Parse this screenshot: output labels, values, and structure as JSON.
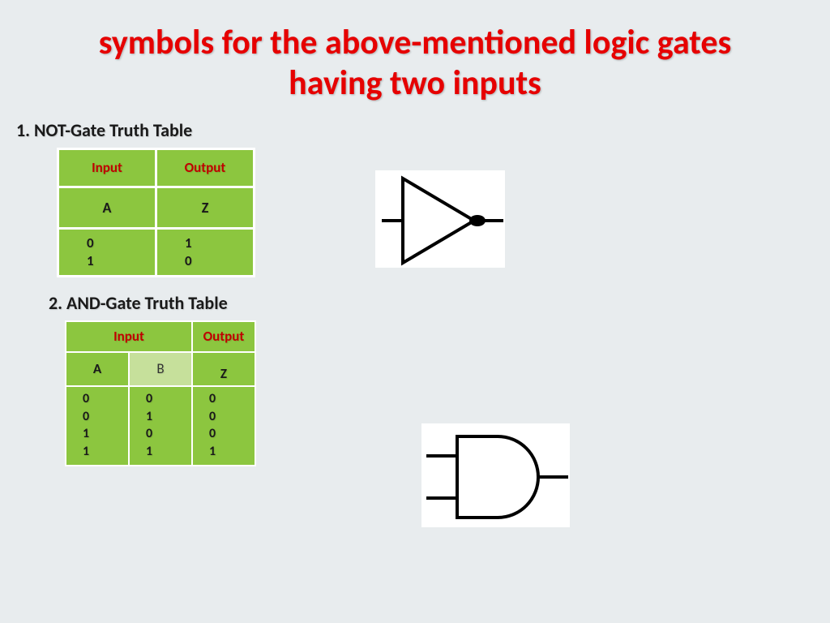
{
  "title": "symbols for the above-mentioned logic gates having two inputs",
  "not_gate": {
    "section": "1. NOT-Gate Truth Table",
    "headers": {
      "in": "Input",
      "out": "Output"
    },
    "labels": {
      "a": "A",
      "z": "Z"
    },
    "col_a": "0\n1",
    "col_z": "1\n0"
  },
  "and_gate": {
    "section": "2. AND-Gate Truth Table",
    "headers": {
      "in": "Input",
      "out": "Output"
    },
    "labels": {
      "a": "A",
      "b": "B",
      "z": "Z"
    },
    "col_a": "0\n0\n1\n1",
    "col_b": "0\n1\n0\n1",
    "col_z": "0\n0\n0\n1"
  },
  "chart_data": [
    {
      "type": "table",
      "title": "NOT-Gate Truth Table",
      "columns": [
        "A",
        "Z"
      ],
      "rows": [
        [
          0,
          1
        ],
        [
          1,
          0
        ]
      ]
    },
    {
      "type": "table",
      "title": "AND-Gate Truth Table",
      "columns": [
        "A",
        "B",
        "Z"
      ],
      "rows": [
        [
          0,
          0,
          0
        ],
        [
          0,
          1,
          0
        ],
        [
          1,
          0,
          0
        ],
        [
          1,
          1,
          1
        ]
      ]
    }
  ]
}
